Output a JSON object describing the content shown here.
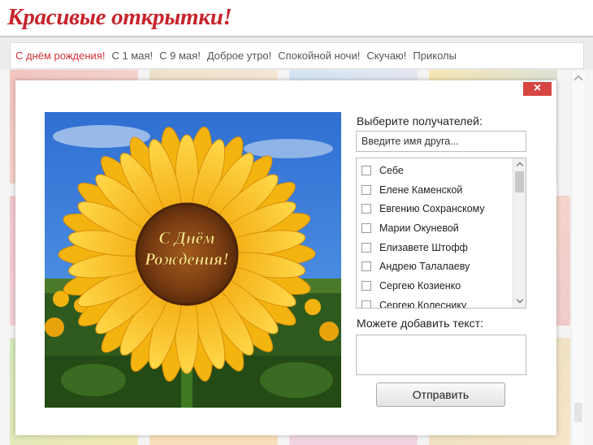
{
  "header": {
    "logo_text": "Красивые открытки!"
  },
  "nav": {
    "items": [
      {
        "label": "С днём рождения!",
        "active": true
      },
      {
        "label": "С 1 мая!",
        "active": false
      },
      {
        "label": "С 9 мая!",
        "active": false
      },
      {
        "label": "Доброе утро!",
        "active": false
      },
      {
        "label": "Спокойной ночи!",
        "active": false
      },
      {
        "label": "Скучаю!",
        "active": false
      },
      {
        "label": "Приколы",
        "active": false
      }
    ]
  },
  "modal": {
    "close_label": "×",
    "card": {
      "greeting_line1": "С Днём",
      "greeting_line2": "Рождения!",
      "icon": "sunflower-image"
    },
    "recipients_title": "Выберите получателей:",
    "friend_search": {
      "placeholder": "Введите имя друга...",
      "value": ""
    },
    "recipients": [
      {
        "name": "Себе",
        "checked": false
      },
      {
        "name": "Елене Каменской",
        "checked": false
      },
      {
        "name": "Евгению Сохранскому",
        "checked": false
      },
      {
        "name": "Марии Окуневой",
        "checked": false
      },
      {
        "name": "Елизавете Штофф",
        "checked": false
      },
      {
        "name": "Андрею Талалаеву",
        "checked": false
      },
      {
        "name": "Сергею Козиенко",
        "checked": false
      },
      {
        "name": "Сергею Колеснику",
        "checked": false
      }
    ],
    "text_title": "Можете добавить текст:",
    "text_value": "",
    "send_label": "Отправить"
  },
  "colors": {
    "brand": "#c7242c",
    "active_nav": "#d0333a",
    "close": "#d64541"
  }
}
